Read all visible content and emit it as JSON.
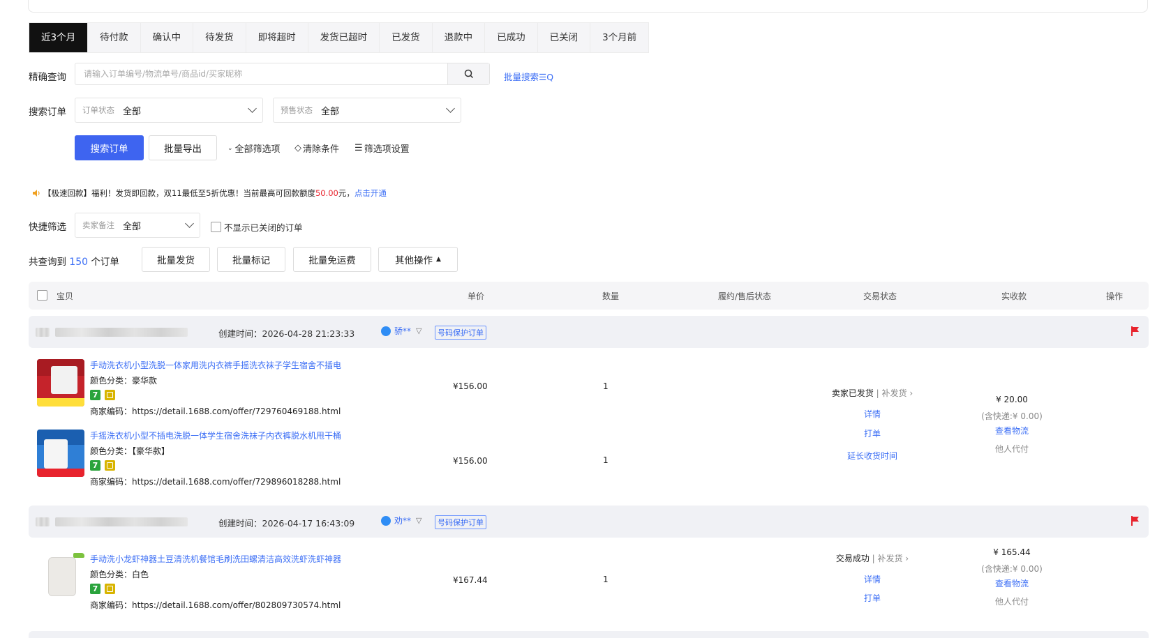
{
  "tabs": [
    "近3个月",
    "待付款",
    "确认中",
    "待发货",
    "即将超时",
    "发货已超时",
    "已发货",
    "退款中",
    "已成功",
    "已关闭",
    "3个月前"
  ],
  "active_tab": "近3个月",
  "precise_query": {
    "label": "精确查询",
    "placeholder": "请输入订单编号/物流单号/商品id/买家昵称",
    "batch_search_label": "批量搜索"
  },
  "search_orders": {
    "label": "搜索订单",
    "order_status": {
      "label": "订单状态",
      "value": "全部"
    },
    "presale_status": {
      "label": "预售状态",
      "value": "全部"
    }
  },
  "actions": {
    "search_button": "搜索订单",
    "export_button": "批量导出",
    "all_filters": "全部筛选项",
    "clear_conditions": "清除条件",
    "filter_settings": "筛选项设置"
  },
  "notice": {
    "prefix": "【极速回款】福利！发货即回款，双11最低至5折优惠！当前最高可回款额度",
    "amount": "50.00",
    "suffix": "元，",
    "link": "点击开通"
  },
  "quick_filter": {
    "label": "快捷筛选",
    "seller_note": {
      "label": "卖家备注",
      "value": "全部"
    },
    "hide_closed_label": "不显示已关闭的订单"
  },
  "summary": {
    "prefix": "共查询到",
    "count": "150",
    "suffix": "个订单"
  },
  "bulk_actions": {
    "ship": "批量发货",
    "mark": "批量标记",
    "free_shipping": "批量免运费",
    "other": "其他操作"
  },
  "table_headers": {
    "item": "宝贝",
    "unit_price": "单价",
    "quantity": "数量",
    "fulfillment": "履约/售后状态",
    "trade_status": "交易状态",
    "received": "实收款",
    "operation": "操作"
  },
  "orders": [
    {
      "created": "创建时间：2026-04-28 21:23:33",
      "buyer": "骄**",
      "protect_tag": "号码保护订单",
      "items": [
        {
          "title": "手动洗衣机小型洗脱一体家用洗内衣裤手摇洗衣袜子学生宿舍不插电",
          "spec": "颜色分类：豪华款",
          "code": "商家编码：https://detail.1688.com/offer/729760469188.html",
          "price": "¥156.00",
          "qty": "1"
        },
        {
          "title": "手摇洗衣机小型不插电洗脱一体学生宿舍洗袜子内衣裤脱水机甩干桶",
          "spec": "颜色分类：【豪华款】",
          "code": "商家编码：https://detail.1688.com/offer/729896018288.html",
          "price": "¥156.00",
          "qty": "1"
        }
      ],
      "trade_status": "卖家已发货",
      "resend": "补发货",
      "detail": "详情",
      "print": "打单",
      "extend": "延长收货时间",
      "amount": "¥ 20.00",
      "shipping_incl": "(含快递:¥ 0.00)",
      "logistics": "查看物流",
      "paid_by": "他人代付"
    },
    {
      "created": "创建时间：2026-04-17 16:43:09",
      "buyer": "劝**",
      "protect_tag": "号码保护订单",
      "items": [
        {
          "title": "手动洗小龙虾神器土豆清洗机餐馆毛刷洗田螺清洁高效洗虾洗虾神器",
          "spec": "颜色分类：白色",
          "code": "商家编码：https://detail.1688.com/offer/802809730574.html",
          "price": "¥167.44",
          "qty": "1"
        }
      ],
      "trade_status": "交易成功",
      "resend": "补发货",
      "detail": "详情",
      "print": "打单",
      "amount": "¥ 165.44",
      "shipping_incl": "(含快递:¥ 0.00)",
      "logistics": "查看物流",
      "paid_by": "他人代付"
    }
  ],
  "colors": {
    "primary": "#3e64f0",
    "link": "#3b6ef5",
    "flag": "#e8232d",
    "active_tab_bg": "#111111"
  }
}
